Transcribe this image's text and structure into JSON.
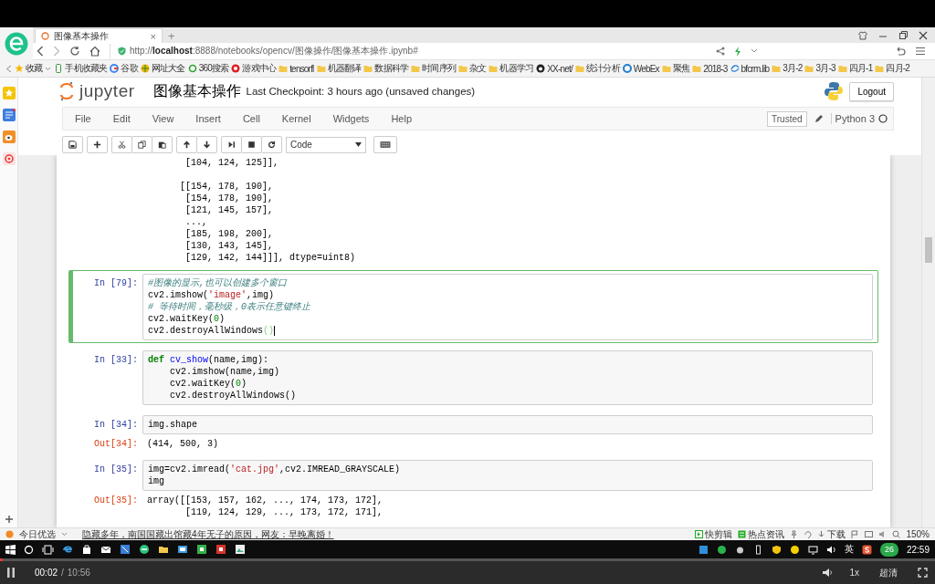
{
  "browser": {
    "tab_title": "图像基本操作",
    "tab_close": "×",
    "new_tab": "+",
    "url": "http://**localhost**:8888/notebooks/opencv/图像操作/图像基本操作.ipynb#",
    "bookmarks": [
      {
        "label": "收藏",
        "kind": "star"
      },
      {
        "label": "手机收藏夹",
        "kind": "phone"
      },
      {
        "label": "谷歌",
        "kind": "google"
      },
      {
        "label": "网址大全",
        "kind": "globe"
      },
      {
        "label": "360搜索",
        "kind": "search"
      },
      {
        "label": "游戏中心",
        "kind": "game"
      },
      {
        "label": "tensorfl",
        "kind": "folder"
      },
      {
        "label": "机器翻译",
        "kind": "folder"
      },
      {
        "label": "数据科学",
        "kind": "folder"
      },
      {
        "label": "时间序列",
        "kind": "folder"
      },
      {
        "label": "杂文",
        "kind": "folder"
      },
      {
        "label": "机器学习",
        "kind": "folder"
      },
      {
        "label": "XX-net/",
        "kind": "github"
      },
      {
        "label": "统计分析",
        "kind": "folder"
      },
      {
        "label": "WebEx",
        "kind": "webex"
      },
      {
        "label": "聚焦",
        "kind": "folder"
      },
      {
        "label": "2018-3",
        "kind": "folder"
      },
      {
        "label": "bfcrm.lib",
        "kind": "link"
      },
      {
        "label": "3月-2",
        "kind": "folder"
      },
      {
        "label": "3月-3",
        "kind": "folder"
      },
      {
        "label": "四月-1",
        "kind": "folder"
      },
      {
        "label": "四月-2",
        "kind": "folder"
      }
    ]
  },
  "jupyter": {
    "logo_text": "jupyter",
    "notebook_name": "图像基本操作",
    "checkpoint": "Last Checkpoint: 3 hours ago (unsaved changes)",
    "logout": "Logout",
    "menu": [
      "File",
      "Edit",
      "View",
      "Insert",
      "Cell",
      "Kernel",
      "Widgets",
      "Help"
    ],
    "trusted": "Trusted",
    "kernel": "Python 3",
    "cell_type": "Code",
    "cells": [
      {
        "kind": "output",
        "blocks": [
          [
            [
              {
                "text": "       [104, 124, 125]],",
                "kind": "plain"
              }
            ]
          ],
          [
            [
              {
                "text": "      [[154, 178, 190],",
                "kind": "plain"
              }
            ],
            [
              {
                "text": "       [154, 178, 190],",
                "kind": "plain"
              }
            ],
            [
              {
                "text": "       [121, 145, 157],",
                "kind": "plain"
              }
            ],
            [
              {
                "text": "       ...,",
                "kind": "plain"
              }
            ],
            [
              {
                "text": "       [185, 198, 200],",
                "kind": "plain"
              }
            ],
            [
              {
                "text": "       [130, 143, 145],",
                "kind": "plain"
              }
            ],
            [
              {
                "text": "       [129, 142, 144]]], dtype=uint8)",
                "kind": "plain"
              }
            ]
          ]
        ]
      },
      {
        "kind": "code",
        "prompt": "In [79]:",
        "selected": true,
        "lines": [
          [
            {
              "text": "#图像的显示,也可以创建多个窗口",
              "kind": "comment"
            }
          ],
          [
            {
              "text": "cv2.imshow(",
              "kind": "plain"
            },
            {
              "text": "'image'",
              "kind": "string"
            },
            {
              "text": ",img)",
              "kind": "plain"
            }
          ],
          [
            {
              "text": "# 等待时间，毫秒级，0表示任意键终止",
              "kind": "comment"
            }
          ],
          [
            {
              "text": "cv2.waitKey(",
              "kind": "plain"
            },
            {
              "text": "0",
              "kind": "number"
            },
            {
              "text": ")",
              "kind": "plain"
            }
          ],
          [
            {
              "text": "cv2.destroyAllWindows",
              "kind": "plain"
            },
            {
              "text": "()",
              "kind": "match"
            }
          ]
        ]
      },
      {
        "kind": "code",
        "prompt": "In [33]:",
        "selected": false,
        "lines": [
          [
            {
              "text": "def",
              "kind": "keyword"
            },
            {
              "text": " cv_show",
              "kind": "name"
            },
            {
              "text": "(name,img):",
              "kind": "plain"
            }
          ],
          [
            {
              "text": "    cv2.imshow(name,img)",
              "kind": "plain"
            }
          ],
          [
            {
              "text": "    cv2.waitKey(",
              "kind": "plain"
            },
            {
              "text": "0",
              "kind": "number"
            },
            {
              "text": ")",
              "kind": "plain"
            }
          ],
          [
            {
              "text": "    cv2.destroyAllWindows()",
              "kind": "plain"
            }
          ]
        ]
      },
      {
        "kind": "code",
        "prompt": "In [34]:",
        "selected": false,
        "lines": [
          [
            {
              "text": "img.shape",
              "kind": "plain"
            }
          ]
        ],
        "output": {
          "prompt": "Out[34]:",
          "lines": [
            [
              {
                "text": "(414, 500, 3)",
                "kind": "plain"
              }
            ]
          ]
        }
      },
      {
        "kind": "code",
        "prompt": "In [35]:",
        "selected": false,
        "lines": [
          [
            {
              "text": "img=cv2.imread(",
              "kind": "plain"
            },
            {
              "text": "'cat.jpg'",
              "kind": "string"
            },
            {
              "text": ",cv2.IMREAD_GRAYSCALE)",
              "kind": "plain"
            }
          ],
          [
            {
              "text": "img",
              "kind": "plain"
            }
          ]
        ],
        "output": {
          "prompt": "Out[35]:",
          "lines": [
            [
              {
                "text": "array([[153, 157, 162, ..., 174, 173, 172],",
                "kind": "plain"
              }
            ],
            [
              {
                "text": "       [119, 124, 129, ..., 173, 172, 171],",
                "kind": "plain"
              }
            ]
          ]
        }
      }
    ]
  },
  "status_bar": {
    "label": "今日优选",
    "news": "隐藏多年，南国国藏出馆藏4年无子的原因，网友：早晚离婚！",
    "items": [
      "快剪辑",
      "热点资讯",
      "下载"
    ],
    "zoom": "150%"
  },
  "taskbar": {
    "ime": "英",
    "badge": "26",
    "time": "22:59"
  },
  "player": {
    "elapsed": "00:02",
    "separator": "/",
    "duration": "10:56",
    "level": 0.003,
    "speed": "1x",
    "quality": "超清"
  }
}
